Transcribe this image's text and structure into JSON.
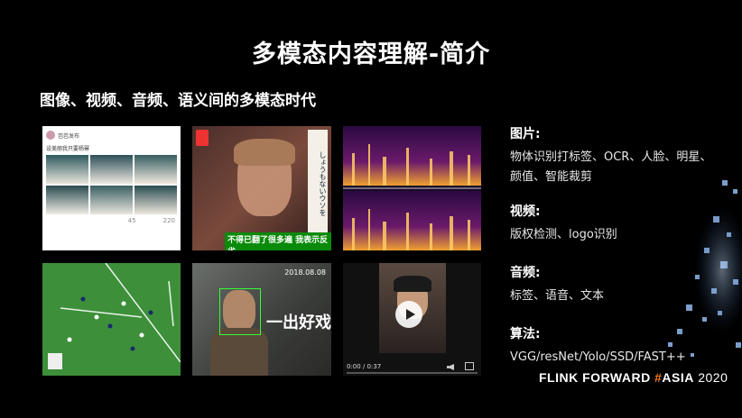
{
  "slide": {
    "title": "多模态内容理解-简介",
    "subtitle": "图像、视频、音频、语义间的多模态时代"
  },
  "sections": [
    {
      "title": "图片:",
      "body": "物体识别打标签、OCR、人脸、明星、颜值、智能裁剪"
    },
    {
      "title": "视频:",
      "body": "版权检测、logo识别"
    },
    {
      "title": "音频:",
      "body": "标签、语音、文本"
    },
    {
      "title": "算法:",
      "body": "VGG/resNet/Yolo/SSD/FAST++"
    }
  ],
  "footer": {
    "brand": "FLINK FORWARD ",
    "hash": "#",
    "asia": "ASIA",
    "year": " 2020"
  },
  "thumbnails": {
    "weibo_header": "芭芭发布",
    "weibo_text": "设美丽我只要杨幂",
    "weibo_count1": "45",
    "weibo_count2": "220",
    "tv_caption": "不得已翻了很多遍 我表示反省",
    "tv_vertical": "しょうもないウソを",
    "movie_date": "2018.08.08",
    "movie_title": "一出好戏",
    "player_time": "0:00 / 0:37"
  },
  "colors": {
    "accent": "#f0781e",
    "background": "#000000"
  }
}
